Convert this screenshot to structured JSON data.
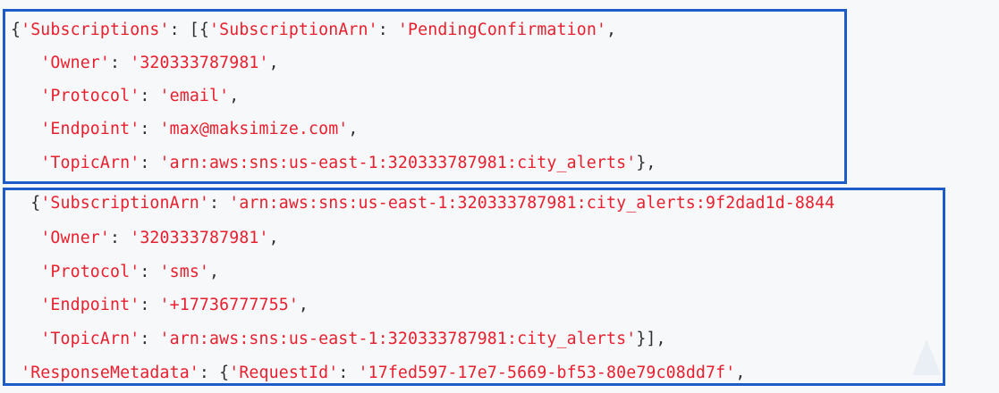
{
  "code": {
    "lines": [
      [
        {
          "t": "{",
          "k": "pun"
        },
        {
          "t": "'Subscriptions'",
          "k": "str"
        },
        {
          "t": ": [{",
          "k": "pun"
        },
        {
          "t": "'SubscriptionArn'",
          "k": "str"
        },
        {
          "t": ": ",
          "k": "pun"
        },
        {
          "t": "'PendingConfirmation'",
          "k": "str"
        },
        {
          "t": ",",
          "k": "pun"
        }
      ],
      [
        {
          "t": "   ",
          "k": "pun"
        },
        {
          "t": "'Owner'",
          "k": "str"
        },
        {
          "t": ": ",
          "k": "pun"
        },
        {
          "t": "'320333787981'",
          "k": "str"
        },
        {
          "t": ",",
          "k": "pun"
        }
      ],
      [
        {
          "t": "   ",
          "k": "pun"
        },
        {
          "t": "'Protocol'",
          "k": "str"
        },
        {
          "t": ": ",
          "k": "pun"
        },
        {
          "t": "'email'",
          "k": "str"
        },
        {
          "t": ",",
          "k": "pun"
        }
      ],
      [
        {
          "t": "   ",
          "k": "pun"
        },
        {
          "t": "'Endpoint'",
          "k": "str"
        },
        {
          "t": ": ",
          "k": "pun"
        },
        {
          "t": "'max@maksimize.com'",
          "k": "str"
        },
        {
          "t": ",",
          "k": "pun"
        }
      ],
      [
        {
          "t": "   ",
          "k": "pun"
        },
        {
          "t": "'TopicArn'",
          "k": "str"
        },
        {
          "t": ": ",
          "k": "pun"
        },
        {
          "t": "'arn:aws:sns:us-east-1:320333787981:city_alerts'",
          "k": "str"
        },
        {
          "t": "},",
          "k": "pun"
        }
      ],
      [
        {
          "t": "  {",
          "k": "pun"
        },
        {
          "t": "'SubscriptionArn'",
          "k": "str"
        },
        {
          "t": ": ",
          "k": "pun"
        },
        {
          "t": "'arn:aws:sns:us-east-1:320333787981:city_alerts:9f2dad1d-8844",
          "k": "str"
        }
      ],
      [
        {
          "t": "   ",
          "k": "pun"
        },
        {
          "t": "'Owner'",
          "k": "str"
        },
        {
          "t": ": ",
          "k": "pun"
        },
        {
          "t": "'320333787981'",
          "k": "str"
        },
        {
          "t": ",",
          "k": "pun"
        }
      ],
      [
        {
          "t": "   ",
          "k": "pun"
        },
        {
          "t": "'Protocol'",
          "k": "str"
        },
        {
          "t": ": ",
          "k": "pun"
        },
        {
          "t": "'sms'",
          "k": "str"
        },
        {
          "t": ",",
          "k": "pun"
        }
      ],
      [
        {
          "t": "   ",
          "k": "pun"
        },
        {
          "t": "'Endpoint'",
          "k": "str"
        },
        {
          "t": ": ",
          "k": "pun"
        },
        {
          "t": "'+17736777755'",
          "k": "str"
        },
        {
          "t": ",",
          "k": "pun"
        }
      ],
      [
        {
          "t": "   ",
          "k": "pun"
        },
        {
          "t": "'TopicArn'",
          "k": "str"
        },
        {
          "t": ": ",
          "k": "pun"
        },
        {
          "t": "'arn:aws:sns:us-east-1:320333787981:city_alerts'",
          "k": "str"
        },
        {
          "t": "}],",
          "k": "pun"
        }
      ],
      [
        {
          "t": " ",
          "k": "pun"
        },
        {
          "t": "'ResponseMetadata'",
          "k": "str"
        },
        {
          "t": ": {",
          "k": "pun"
        },
        {
          "t": "'RequestId'",
          "k": "str"
        },
        {
          "t": ": ",
          "k": "pun"
        },
        {
          "t": "'17fed597-17e7-5669-bf53-80e79c08dd7f'",
          "k": "str"
        },
        {
          "t": ",",
          "k": "pun"
        }
      ]
    ]
  },
  "colors": {
    "string": "#e8202e",
    "punctuation": "#2e2e2e",
    "highlight_border": "#1c5bc9",
    "background": "#f6f8fa"
  }
}
